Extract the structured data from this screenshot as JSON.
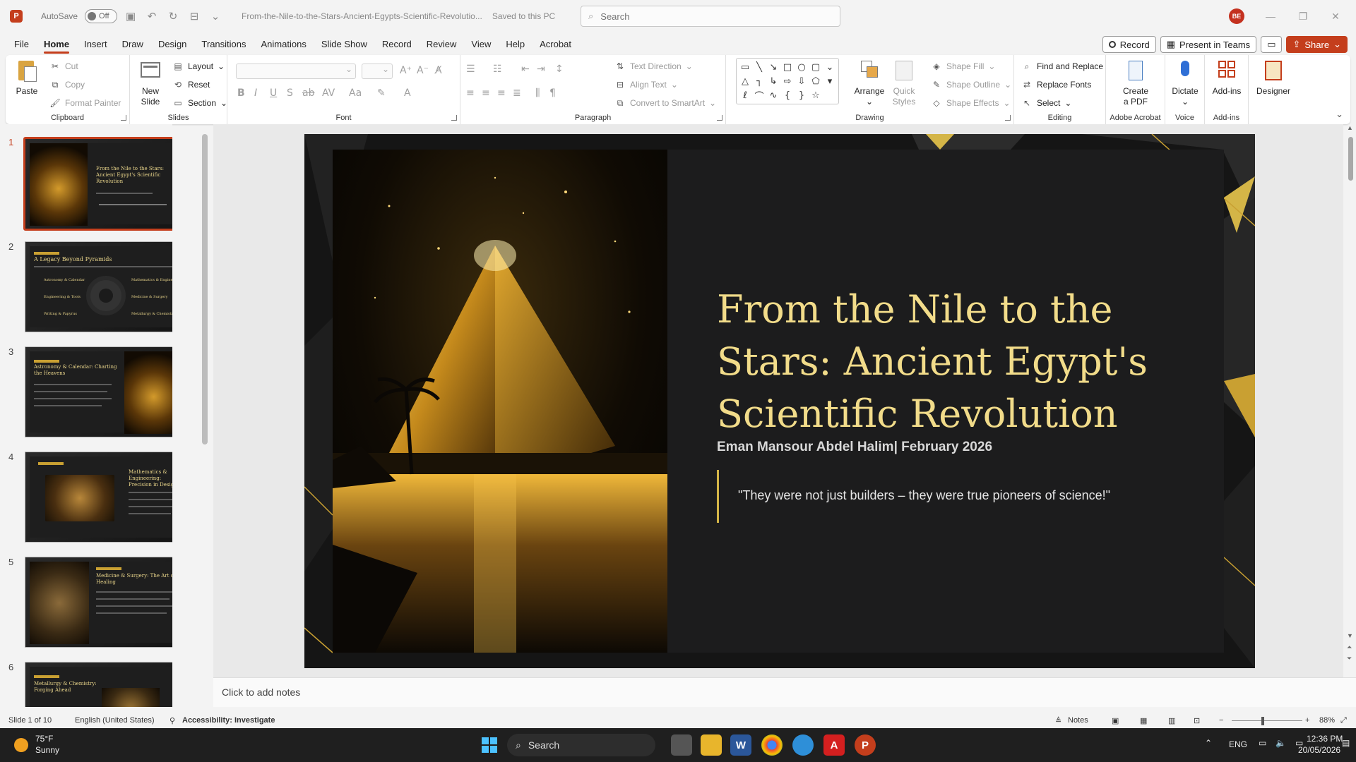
{
  "titlebar": {
    "autosave_label": "AutoSave",
    "autosave_state": "Off",
    "doc_title": "From-the-Nile-to-the-Stars-Ancient-Egypts-Scientific-Revolutio...",
    "saved_state": "Saved to this PC",
    "search_placeholder": "Search",
    "user_initials": "BE"
  },
  "tabs": [
    "File",
    "Home",
    "Insert",
    "Draw",
    "Design",
    "Transitions",
    "Animations",
    "Slide Show",
    "Record",
    "Review",
    "View",
    "Help",
    "Acrobat"
  ],
  "active_tab": "Home",
  "tab_actions": {
    "record": "Record",
    "present": "Present in Teams",
    "share": "Share"
  },
  "ribbon": {
    "clipboard": {
      "label": "Clipboard",
      "paste": "Paste",
      "cut": "Cut",
      "copy": "Copy",
      "format_painter": "Format Painter"
    },
    "slides": {
      "label": "Slides",
      "new_slide_1": "New",
      "new_slide_2": "Slide",
      "layout": "Layout",
      "reset": "Reset",
      "section": "Section"
    },
    "font": {
      "label": "Font"
    },
    "paragraph": {
      "label": "Paragraph",
      "text_direction": "Text Direction",
      "align_text": "Align Text",
      "smartart": "Convert to SmartArt"
    },
    "drawing": {
      "label": "Drawing",
      "arrange": "Arrange",
      "quick_styles_1": "Quick",
      "quick_styles_2": "Styles",
      "shape_fill": "Shape Fill",
      "shape_outline": "Shape Outline",
      "shape_effects": "Shape Effects"
    },
    "editing": {
      "label": "Editing",
      "find_replace": "Find and Replace",
      "replace_fonts": "Replace Fonts",
      "select": "Select"
    },
    "acrobat": {
      "label": "Adobe Acrobat",
      "create_pdf_1": "Create",
      "create_pdf_2": "a PDF"
    },
    "voice": {
      "label": "Voice",
      "dictate": "Dictate"
    },
    "addins": {
      "label": "Add-ins",
      "addins": "Add-ins"
    },
    "designer": {
      "designer": "Designer"
    }
  },
  "thumbnails": [
    {
      "num": "1",
      "title": "From the Nile to the Stars: Ancient Egypt's Scientific Revolution"
    },
    {
      "num": "2",
      "title": "A Legacy Beyond Pyramids"
    },
    {
      "num": "3",
      "title": "Astronomy & Calendar: Charting the Heavens"
    },
    {
      "num": "4",
      "title": "Mathematics & Engineering: Precision in Design"
    },
    {
      "num": "5",
      "title": "Medicine & Surgery: The Art of Healing"
    },
    {
      "num": "6",
      "title": "Metallurgy & Chemistry: Forging Ahead"
    }
  ],
  "thumb2_labels": [
    "Astronomy & Calendar",
    "Mathematics & Engineering",
    "Engineering & Tools",
    "Medicine & Surgery",
    "Writing & Papyrus",
    "Metallurgy & Chemistry"
  ],
  "slide": {
    "title": "From the Nile to the Stars: Ancient Egypt's Scientific Revolution",
    "subtitle": "Eman Mansour Abdel Halim| February 2026",
    "quote": "\"They were not just builders – they were true pioneers of science!\""
  },
  "notes_placeholder": "Click to add notes",
  "statusbar": {
    "slide_counter": "Slide 1 of 10",
    "language": "English (United States)",
    "accessibility": "Accessibility: Investigate",
    "notes": "Notes",
    "zoom": "88%"
  },
  "taskbar": {
    "weather_temp": "75°F",
    "weather_desc": "Sunny",
    "search": "Search",
    "lang": "ENG",
    "time": "12:36 PM",
    "date": "20/05/2026"
  },
  "colors": {
    "accent": "#c43e1c",
    "slide_title": "#f2dc8a",
    "gold": "#d4b547"
  }
}
